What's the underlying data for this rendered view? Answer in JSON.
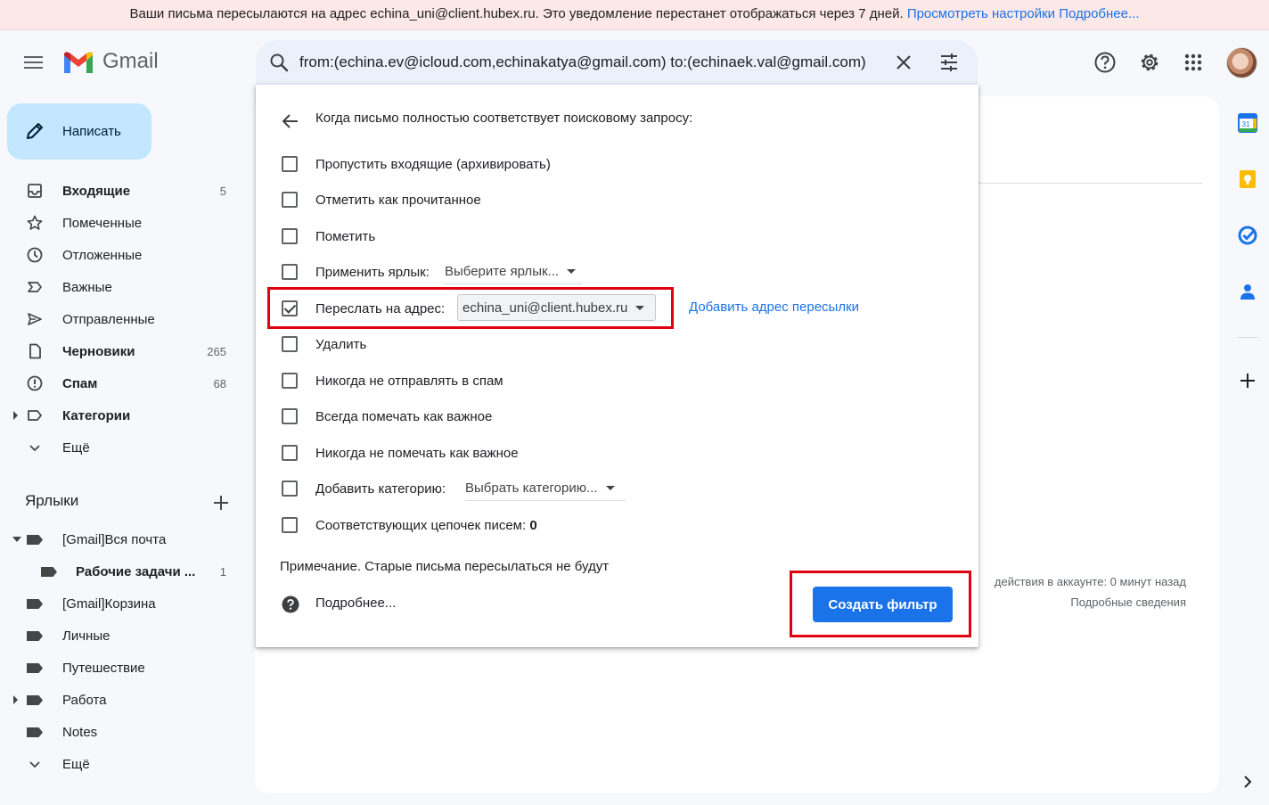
{
  "banner": {
    "text": "Ваши письма пересылаются на адрес echina_uni@client.hubex.ru. Это уведомление перестанет отображаться через 7 дней.",
    "link_settings": "Просмотреть настройки",
    "link_more": "Подробнее..."
  },
  "header": {
    "logo_text": "Gmail",
    "search_query": "from:(echina.ev@icloud.com,echinakatya@gmail.com) to:(echinaek.val@gmail.com)",
    "icons": [
      "menu-icon",
      "search-icon",
      "clear-icon",
      "tune-icon",
      "help-icon",
      "settings-icon",
      "apps-icon"
    ]
  },
  "compose": {
    "label": "Написать"
  },
  "nav": {
    "items": [
      {
        "label": "Входящие",
        "count": "5",
        "icon": "inbox-icon",
        "bold": true
      },
      {
        "label": "Помеченные",
        "count": "",
        "icon": "star-icon",
        "bold": false
      },
      {
        "label": "Отложенные",
        "count": "",
        "icon": "clock-icon",
        "bold": false
      },
      {
        "label": "Важные",
        "count": "",
        "icon": "important-icon",
        "bold": false
      },
      {
        "label": "Отправленные",
        "count": "",
        "icon": "send-icon",
        "bold": false
      },
      {
        "label": "Черновики",
        "count": "265",
        "icon": "draft-icon",
        "bold": true
      },
      {
        "label": "Спам",
        "count": "68",
        "icon": "spam-icon",
        "bold": true
      },
      {
        "label": "Категории",
        "count": "",
        "icon": "category-icon",
        "bold": true
      },
      {
        "label": "Ещё",
        "count": "",
        "icon": "chevron-down-icon",
        "bold": false
      }
    ]
  },
  "labels": {
    "heading": "Ярлыки",
    "items": [
      {
        "label": "[Gmail]Вся почта",
        "count": ""
      },
      {
        "label": "Рабочие задачи ...",
        "count": "1"
      },
      {
        "label": "[Gmail]Корзина",
        "count": ""
      },
      {
        "label": "Личные",
        "count": ""
      },
      {
        "label": "Путешествие",
        "count": ""
      },
      {
        "label": "Работа",
        "count": ""
      },
      {
        "label": "Notes",
        "count": ""
      },
      {
        "label": "Ещё",
        "count": ""
      }
    ]
  },
  "filter": {
    "heading": "Когда письмо полностью соответствует поисковому запросу:",
    "options": [
      {
        "label": "Пропустить входящие (архивировать)",
        "checked": false
      },
      {
        "label": "Отметить как прочитанное",
        "checked": false
      },
      {
        "label": "Пометить",
        "checked": false
      },
      {
        "label": "Применить ярлык:",
        "checked": false
      },
      {
        "label": "Переслать на адрес:",
        "checked": true
      },
      {
        "label": "Удалить",
        "checked": false
      },
      {
        "label": "Никогда не отправлять в спам",
        "checked": false
      },
      {
        "label": "Всегда помечать как важное",
        "checked": false
      },
      {
        "label": "Никогда не помечать как важное",
        "checked": false
      },
      {
        "label": "Добавить категорию:",
        "checked": false
      },
      {
        "label": "Соответствующих цепочек писем:",
        "checked": false
      }
    ],
    "label_dropdown": "Выберите ярлык...",
    "forward_dropdown": "echina_uni@client.hubex.ru",
    "add_forward_link": "Добавить адрес пересылки",
    "category_dropdown": "Выбрать категорию...",
    "thread_count": "0",
    "note": "Примечание. Старые письма пересылаться не будут",
    "help_link": "Подробнее...",
    "create_button": "Создать фильтр"
  },
  "activity": {
    "last_activity": "действия в аккаунте: 0 минут назад",
    "details_link": "Подробные сведения"
  },
  "side_panel": {
    "calendar_day": "31",
    "icons": [
      "calendar-icon",
      "keep-icon",
      "tasks-icon",
      "contacts-icon",
      "add-icon",
      "chevron-right-icon"
    ]
  },
  "colors": {
    "banner_bg": "#fce8e6",
    "compose_bg": "#c2e7ff",
    "accent": "#1a73e8",
    "highlight": "#e0000f"
  }
}
